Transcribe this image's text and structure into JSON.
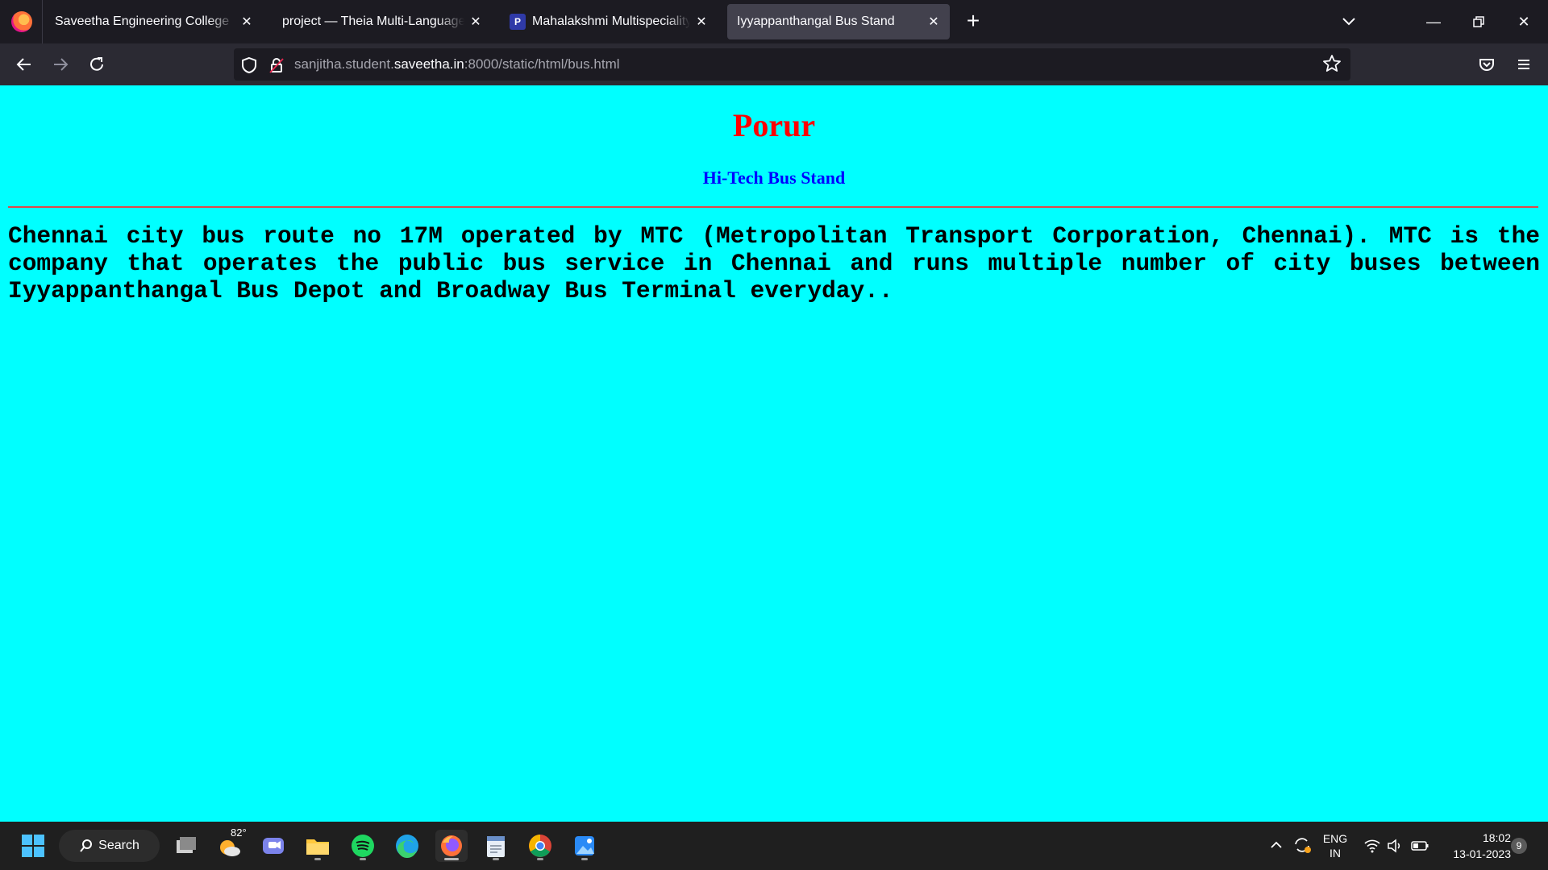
{
  "browser": {
    "tabs": [
      {
        "title": "Saveetha Engineering College",
        "active": false
      },
      {
        "title": "project — Theia Multi-Language Ex",
        "active": false
      },
      {
        "title": "Mahalakshmi Multispeciality Ho",
        "active": false,
        "favicon": "P"
      },
      {
        "title": "Iyyappanthangal Bus Stand",
        "active": true
      }
    ],
    "url": {
      "prefix": "sanjitha.student.",
      "host": "saveetha.in",
      "suffix": ":8000/static/html/bus.html"
    }
  },
  "page": {
    "title": "Porur",
    "subtitle": "Hi-Tech Bus Stand",
    "body": "Chennai city bus route no 17M operated by MTC (Metropolitan Transport Corporation, Chennai). MTC is the company that operates the public bus service in Chennai and runs multiple number of city buses between Iyyappanthangal Bus Depot and Broadway Bus Terminal everyday..",
    "background_color": "#00ffff",
    "title_color": "#ff0000",
    "subtitle_color": "#0000ff"
  },
  "taskbar": {
    "search_label": "Search",
    "weather_temp": "82°",
    "language_line1": "ENG",
    "language_line2": "IN",
    "time": "18:02",
    "date": "13-01-2023",
    "notification_count": "9"
  }
}
